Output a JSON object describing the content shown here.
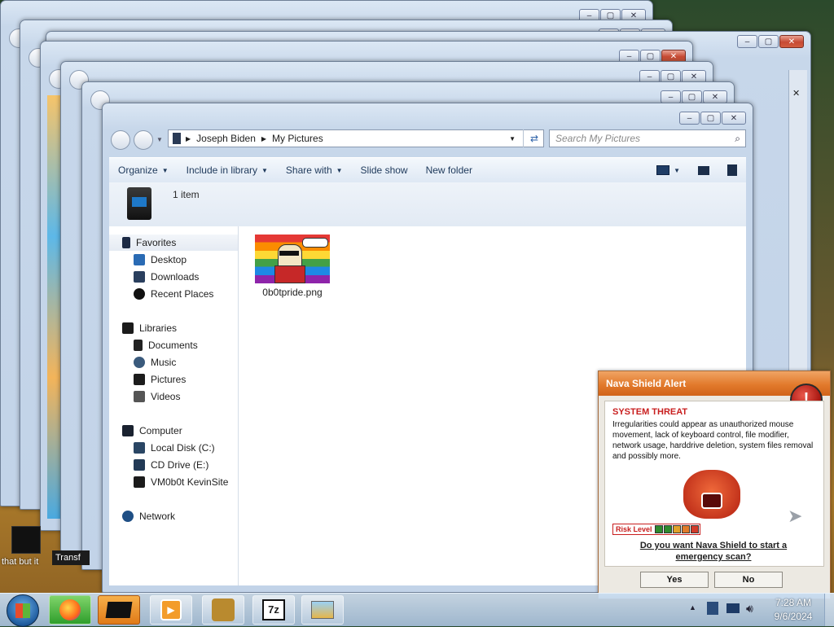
{
  "explorer": {
    "breadcrumb": [
      "Joseph Biden",
      "My Pictures"
    ],
    "search_placeholder": "Search My Pictures",
    "toolbar": [
      "Organize",
      "Include in library",
      "Share with",
      "Slide show",
      "New folder"
    ],
    "item_count": "1 item",
    "nav": {
      "favorites": "Favorites",
      "favorites_items": [
        "Desktop",
        "Downloads",
        "Recent Places"
      ],
      "libraries": "Libraries",
      "libraries_items": [
        "Documents",
        "Music",
        "Pictures",
        "Videos"
      ],
      "computer": "Computer",
      "computer_items": [
        "Local Disk (C:)",
        "CD Drive (E:)",
        "VM0b0t KevinSite"
      ],
      "network": "Network"
    },
    "file": {
      "name": "0b0tpride.png"
    }
  },
  "nava": {
    "title": "Nava Shield Alert",
    "heading": "SYSTEM THREAT",
    "message": "Irregularities could appear as unauthorized mouse movement, lack of keyboard control, file modifier, network usage, harddrive deletion, system files removal and possibly more.",
    "risk_label": "Risk Level",
    "question": "Do you want Nava Shield to start a emergency scan?",
    "yes": "Yes",
    "no": "No"
  },
  "desktop": {
    "label_left": "that but it",
    "label_partial": "Transf"
  },
  "tray": {
    "time": "7:28 AM",
    "date": "9/6/2024"
  }
}
